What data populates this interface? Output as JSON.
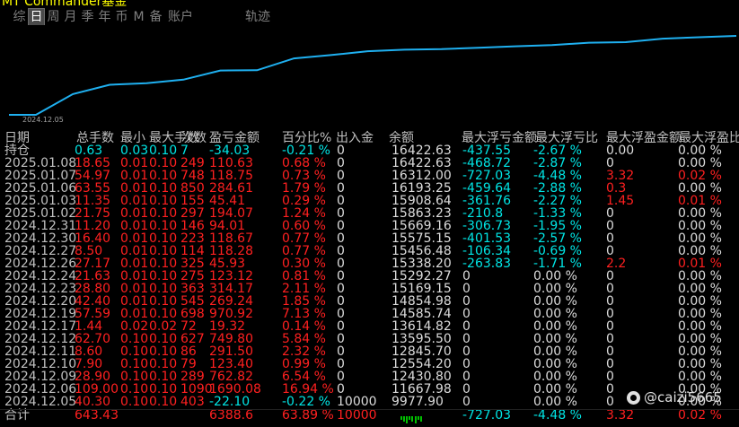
{
  "window": {
    "title": "MT Commander基金"
  },
  "tabs": [
    {
      "label": "综",
      "active": false
    },
    {
      "label": "日",
      "active": true
    },
    {
      "label": "周",
      "active": false
    },
    {
      "label": "月",
      "active": false
    },
    {
      "label": "季",
      "active": false
    },
    {
      "label": "年",
      "active": false
    },
    {
      "label": "币",
      "active": false
    },
    {
      "label": "M",
      "active": false
    },
    {
      "label": "备",
      "active": false
    },
    {
      "label": "账户",
      "active": false
    },
    {
      "label": "轨迹",
      "active": false
    }
  ],
  "chart": {
    "x_label": "2024.12.05",
    "line_color": "#1fb0f0",
    "points": [
      [
        "2024.12.05",
        9977.9
      ],
      [
        "2024.12.06",
        11667.98
      ],
      [
        "2024.12.09",
        12430.8
      ],
      [
        "2024.12.10",
        12554.2
      ],
      [
        "2024.12.11",
        12845.7
      ],
      [
        "2024.12.12",
        13595.5
      ],
      [
        "2024.12.17",
        13614.82
      ],
      [
        "2024.12.19",
        14585.74
      ],
      [
        "2024.12.20",
        14854.98
      ],
      [
        "2024.12.23",
        15169.15
      ],
      [
        "2024.12.24",
        15292.27
      ],
      [
        "2024.12.26",
        15338.2
      ],
      [
        "2024.12.27",
        15456.48
      ],
      [
        "2024.12.30",
        15575.15
      ],
      [
        "2024.12.31",
        15669.16
      ],
      [
        "2025.01.02",
        15863.23
      ],
      [
        "2025.01.03",
        15908.64
      ],
      [
        "2025.01.06",
        16193.25
      ],
      [
        "2025.01.07",
        16312.0
      ],
      [
        "2025.01.08",
        16422.63
      ]
    ]
  },
  "table": {
    "headers": [
      "日期",
      "总手数",
      "最小",
      "最大手数",
      "次数",
      "盈亏金额",
      "百分比%",
      "出入金",
      "余额",
      "最大浮亏金额",
      "最大浮亏比",
      "最大浮盈金额",
      "最大浮盈比"
    ],
    "holding": {
      "date": "持仓",
      "lots": "0.63",
      "min": "0.03",
      "max": "0.10",
      "count": "7",
      "pl": "-34.03",
      "pct": "-0.21 %",
      "io": "0",
      "balance": "16422.63",
      "mfl": "-437.55",
      "mflp": "-2.67 %",
      "mfp": "0.00",
      "mfpp": "0.00 %"
    },
    "rows": [
      {
        "date": "2025.01.08",
        "lots": "18.65",
        "min": "0.01",
        "max": "0.10",
        "count": "249",
        "pl": "110.63",
        "pct": "0.68 %",
        "io": "0",
        "balance": "16422.63",
        "mfl": "-468.72",
        "mflp": "-2.87 %",
        "mfp": "0",
        "mfpp": "0.00 %"
      },
      {
        "date": "2025.01.07",
        "lots": "54.97",
        "min": "0.01",
        "max": "0.10",
        "count": "748",
        "pl": "118.75",
        "pct": "0.73 %",
        "io": "0",
        "balance": "16312.00",
        "mfl": "-727.03",
        "mflp": "-4.48 %",
        "mfp": "3.32",
        "mfpp": "0.02 %"
      },
      {
        "date": "2025.01.06",
        "lots": "63.55",
        "min": "0.01",
        "max": "0.10",
        "count": "850",
        "pl": "284.61",
        "pct": "1.79 %",
        "io": "0",
        "balance": "16193.25",
        "mfl": "-459.64",
        "mflp": "-2.88 %",
        "mfp": "0.3",
        "mfpp": "0.00 %"
      },
      {
        "date": "2025.01.03",
        "lots": "11.35",
        "min": "0.01",
        "max": "0.10",
        "count": "155",
        "pl": "45.41",
        "pct": "0.29 %",
        "io": "0",
        "balance": "15908.64",
        "mfl": "-361.76",
        "mflp": "-2.27 %",
        "mfp": "1.45",
        "mfpp": "0.01 %"
      },
      {
        "date": "2025.01.02",
        "lots": "21.75",
        "min": "0.01",
        "max": "0.10",
        "count": "297",
        "pl": "194.07",
        "pct": "1.24 %",
        "io": "0",
        "balance": "15863.23",
        "mfl": "-210.8",
        "mflp": "-1.33 %",
        "mfp": "0",
        "mfpp": "0.00 %"
      },
      {
        "date": "2024.12.31",
        "lots": "11.20",
        "min": "0.01",
        "max": "0.10",
        "count": "146",
        "pl": "94.01",
        "pct": "0.60 %",
        "io": "0",
        "balance": "15669.16",
        "mfl": "-306.73",
        "mflp": "-1.95 %",
        "mfp": "0",
        "mfpp": "0.00 %"
      },
      {
        "date": "2024.12.30",
        "lots": "16.40",
        "min": "0.01",
        "max": "0.10",
        "count": "223",
        "pl": "118.67",
        "pct": "0.77 %",
        "io": "0",
        "balance": "15575.15",
        "mfl": "-401.53",
        "mflp": "-2.57 %",
        "mfp": "0",
        "mfpp": "0.00 %"
      },
      {
        "date": "2024.12.27",
        "lots": "8.50",
        "min": "0.01",
        "max": "0.10",
        "count": "114",
        "pl": "118.28",
        "pct": "0.77 %",
        "io": "0",
        "balance": "15456.48",
        "mfl": "-106.34",
        "mflp": "-0.69 %",
        "mfp": "0",
        "mfpp": "0.00 %"
      },
      {
        "date": "2024.12.26",
        "lots": "27.17",
        "min": "0.01",
        "max": "0.10",
        "count": "325",
        "pl": "45.93",
        "pct": "0.30 %",
        "io": "0",
        "balance": "15338.20",
        "mfl": "-263.83",
        "mflp": "-1.71 %",
        "mfp": "2.2",
        "mfpp": "0.01 %"
      },
      {
        "date": "2024.12.24",
        "lots": "21.63",
        "min": "0.01",
        "max": "0.10",
        "count": "275",
        "pl": "123.12",
        "pct": "0.81 %",
        "io": "0",
        "balance": "15292.27",
        "mfl": "0",
        "mflp": "0.00 %",
        "mfp": "0",
        "mfpp": "0.00 %"
      },
      {
        "date": "2024.12.23",
        "lots": "28.80",
        "min": "0.01",
        "max": "0.10",
        "count": "363",
        "pl": "314.17",
        "pct": "2.11 %",
        "io": "0",
        "balance": "15169.15",
        "mfl": "0",
        "mflp": "0.00 %",
        "mfp": "0",
        "mfpp": "0.00 %"
      },
      {
        "date": "2024.12.20",
        "lots": "42.40",
        "min": "0.01",
        "max": "0.10",
        "count": "545",
        "pl": "269.24",
        "pct": "1.85 %",
        "io": "0",
        "balance": "14854.98",
        "mfl": "0",
        "mflp": "0.00 %",
        "mfp": "0",
        "mfpp": "0.00 %"
      },
      {
        "date": "2024.12.19",
        "lots": "57.59",
        "min": "0.01",
        "max": "0.10",
        "count": "698",
        "pl": "970.92",
        "pct": "7.13 %",
        "io": "0",
        "balance": "14585.74",
        "mfl": "0",
        "mflp": "0.00 %",
        "mfp": "0",
        "mfpp": "0.00 %"
      },
      {
        "date": "2024.12.17",
        "lots": "1.44",
        "min": "0.02",
        "max": "0.02",
        "count": "72",
        "pl": "19.32",
        "pct": "0.14 %",
        "io": "0",
        "balance": "13614.82",
        "mfl": "0",
        "mflp": "0.00 %",
        "mfp": "0",
        "mfpp": "0.00 %"
      },
      {
        "date": "2024.12.12",
        "lots": "62.70",
        "min": "0.10",
        "max": "0.10",
        "count": "627",
        "pl": "749.80",
        "pct": "5.84 %",
        "io": "0",
        "balance": "13595.50",
        "mfl": "0",
        "mflp": "0.00 %",
        "mfp": "0",
        "mfpp": "0.00 %"
      },
      {
        "date": "2024.12.11",
        "lots": "8.60",
        "min": "0.10",
        "max": "0.10",
        "count": "86",
        "pl": "291.50",
        "pct": "2.32 %",
        "io": "0",
        "balance": "12845.70",
        "mfl": "0",
        "mflp": "0.00 %",
        "mfp": "0",
        "mfpp": "0.00 %"
      },
      {
        "date": "2024.12.10",
        "lots": "7.90",
        "min": "0.10",
        "max": "0.10",
        "count": "79",
        "pl": "123.40",
        "pct": "0.99 %",
        "io": "0",
        "balance": "12554.20",
        "mfl": "0",
        "mflp": "0.00 %",
        "mfp": "0",
        "mfpp": "0.00 %"
      },
      {
        "date": "2024.12.09",
        "lots": "28.90",
        "min": "0.10",
        "max": "0.10",
        "count": "289",
        "pl": "762.82",
        "pct": "6.54 %",
        "io": "0",
        "balance": "12430.80",
        "mfl": "0",
        "mflp": "0.00 %",
        "mfp": "0",
        "mfpp": "0.00 %"
      },
      {
        "date": "2024.12.06",
        "lots": "109.00",
        "min": "0.10",
        "max": "0.10",
        "count": "1090",
        "pl": "1690.08",
        "pct": "16.94 %",
        "io": "0",
        "balance": "11667.98",
        "mfl": "0",
        "mflp": "0.00 %",
        "mfp": "0",
        "mfpp": "0.00 %"
      },
      {
        "date": "2024.12.05",
        "lots": "40.30",
        "min": "0.10",
        "max": "0.10",
        "count": "403",
        "pl": "-22.10",
        "pct": "-0.22 %",
        "io": "10000",
        "balance": "9977.90",
        "mfl": "0",
        "mflp": "0.00 %",
        "mfp": "0",
        "mfpp": "0.00 %"
      }
    ],
    "total": {
      "date": "合计",
      "lots": "643.43",
      "pl": "6388.6",
      "pct": "63.89 %",
      "io": "10000",
      "mfl": "-727.03",
      "mflp": "-4.48 %",
      "mfp": "3.32",
      "mfpp": "0.02 %"
    }
  },
  "watermark": {
    "text": "@caizi5665"
  },
  "colors": {
    "positive": "#ff2020",
    "negative": "#00e5e5",
    "neutral": "#dcdcdc",
    "date": "#c0c0c0",
    "title": "#ffff00"
  }
}
